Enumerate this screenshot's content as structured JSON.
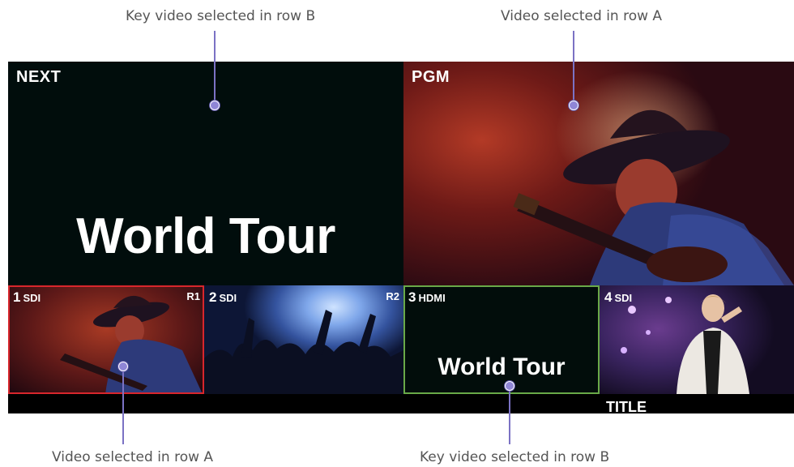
{
  "callouts": {
    "top_left": "Key video selected in row B",
    "top_right": "Video selected in row A",
    "bottom_left": "Video selected in row A",
    "bottom_right": "Key video selected in row B"
  },
  "next": {
    "label": "NEXT",
    "title_text": "World Tour"
  },
  "pgm": {
    "label": "PGM"
  },
  "inputs": [
    {
      "num": "1",
      "signal": "SDI",
      "tally": "R1",
      "frame_color": "#d8262c"
    },
    {
      "num": "2",
      "signal": "SDI",
      "tally": "R2",
      "frame_color": ""
    },
    {
      "num": "3",
      "signal": "HDMI",
      "tally": "",
      "title_text": "World Tour",
      "frame_color": "#69a948"
    },
    {
      "num": "4",
      "signal": "SDI",
      "tally": "",
      "frame_color": ""
    }
  ],
  "bottom": {
    "label": "TITLE"
  },
  "colors": {
    "callout_line": "#7b72c4",
    "callout_dot": "#8f86d6",
    "selected_row_a": "#d8262c",
    "selected_row_b": "#69a948"
  }
}
